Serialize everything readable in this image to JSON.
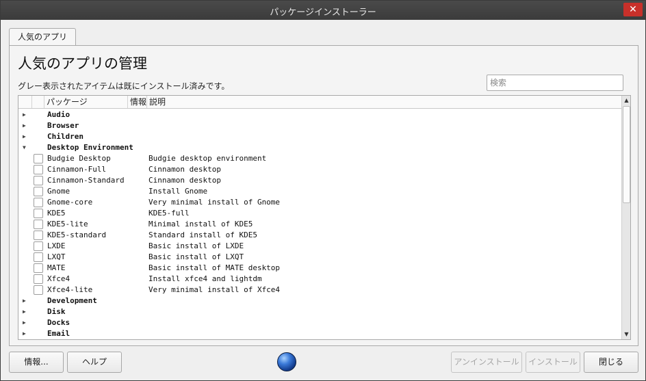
{
  "window": {
    "title": "パッケージインストーラー",
    "close_glyph": "✕"
  },
  "tabs": [
    {
      "label": "人気のアプリ"
    }
  ],
  "main": {
    "heading": "人気のアプリの管理",
    "subtext": "グレー表示されたアイテムは既にインストール済みです。",
    "search_placeholder": "検索"
  },
  "tree": {
    "columns": {
      "package": "パッケージ",
      "info": "情報",
      "description": "説明"
    },
    "rows": [
      {
        "kind": "category",
        "name": "Audio",
        "expanded": false
      },
      {
        "kind": "category",
        "name": "Browser",
        "expanded": false
      },
      {
        "kind": "category",
        "name": "Children",
        "expanded": false
      },
      {
        "kind": "category",
        "name": "Desktop Environment",
        "expanded": true
      },
      {
        "kind": "item",
        "name": "Budgie Desktop",
        "description": "Budgie desktop environment"
      },
      {
        "kind": "item",
        "name": "Cinnamon-Full",
        "description": "Cinnamon desktop"
      },
      {
        "kind": "item",
        "name": "Cinnamon-Standard",
        "description": "Cinnamon desktop"
      },
      {
        "kind": "item",
        "name": "Gnome",
        "description": "Install Gnome"
      },
      {
        "kind": "item",
        "name": "Gnome-core",
        "description": "Very minimal install of Gnome"
      },
      {
        "kind": "item",
        "name": "KDE5",
        "description": "KDE5-full"
      },
      {
        "kind": "item",
        "name": "KDE5-lite",
        "description": "Minimal install of KDE5"
      },
      {
        "kind": "item",
        "name": "KDE5-standard",
        "description": "Standard install of KDE5"
      },
      {
        "kind": "item",
        "name": "LXDE",
        "description": "Basic install of LXDE"
      },
      {
        "kind": "item",
        "name": "LXQT",
        "description": "Basic install of LXQT"
      },
      {
        "kind": "item",
        "name": "MATE",
        "description": "Basic install of MATE desktop"
      },
      {
        "kind": "item",
        "name": "Xfce4",
        "description": "Install xfce4 and lightdm"
      },
      {
        "kind": "item",
        "name": "Xfce4-lite",
        "description": "Very minimal install of Xfce4"
      },
      {
        "kind": "category",
        "name": "Development",
        "expanded": false
      },
      {
        "kind": "category",
        "name": "Disk",
        "expanded": false
      },
      {
        "kind": "category",
        "name": "Docks",
        "expanded": false
      },
      {
        "kind": "category",
        "name": "Email",
        "expanded": false
      }
    ],
    "glyphs": {
      "collapsed": "▶",
      "expanded": "▼",
      "scroll_up": "▲",
      "scroll_down": "▼"
    }
  },
  "footer": {
    "about_label": "情報...",
    "help_label": "ヘルプ",
    "uninstall_label": "アンインストール",
    "install_label": "インストール",
    "close_label": "閉じる"
  },
  "icons": {
    "app_logo": "globe-icon"
  }
}
